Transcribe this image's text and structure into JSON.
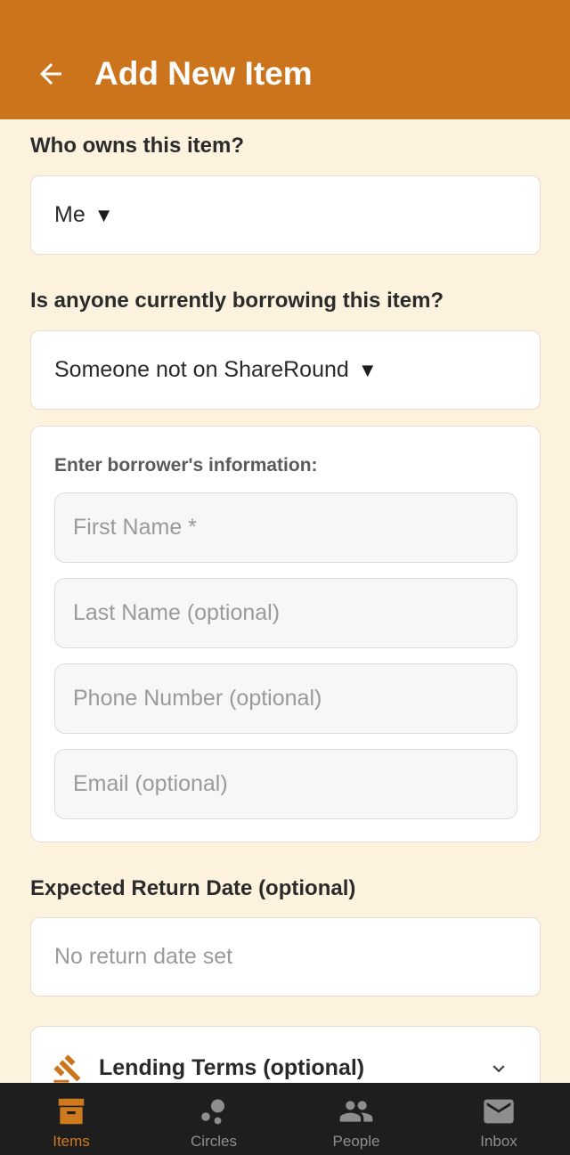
{
  "header": {
    "title": "Add New Item",
    "back_icon": "arrow-left-icon"
  },
  "owner": {
    "label": "Who owns this item?",
    "value": "Me",
    "caret": "▼"
  },
  "borrowing": {
    "label": "Is anyone currently borrowing this item?",
    "value": "Someone not on ShareRound",
    "caret": "▼"
  },
  "borrower": {
    "label": "Enter borrower's information:",
    "first_name_placeholder": "First Name *",
    "last_name_placeholder": "Last Name (optional)",
    "phone_placeholder": "Phone Number (optional)",
    "email_placeholder": "Email (optional)"
  },
  "return_date": {
    "label": "Expected Return Date (optional)",
    "value": "No return date set"
  },
  "lending_terms": {
    "title": "Lending Terms (optional)",
    "icon": "gavel-icon",
    "chevron": "chevron-down-icon"
  },
  "nav": {
    "items": [
      {
        "label": "Items",
        "icon": "archive-box-icon",
        "active": true
      },
      {
        "label": "Circles",
        "icon": "circles-icon",
        "active": false
      },
      {
        "label": "People",
        "icon": "people-icon",
        "active": false
      },
      {
        "label": "Inbox",
        "icon": "mail-icon",
        "active": false
      }
    ]
  },
  "colors": {
    "brand": "#cb741c",
    "background": "#fdf2de",
    "nav_bg": "#1e1e1e",
    "nav_active": "#d07a20",
    "nav_inactive": "#8e8e8e"
  }
}
